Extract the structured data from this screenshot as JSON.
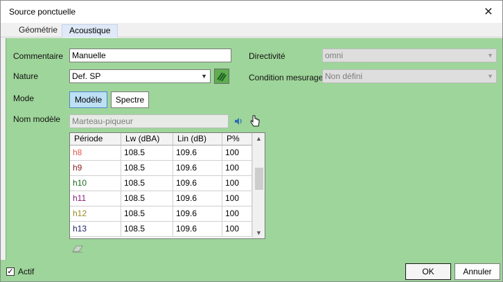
{
  "window": {
    "title": "Source ponctuelle",
    "close_glyph": "✕"
  },
  "tabs": [
    {
      "label": "Géométrie",
      "active": false
    },
    {
      "label": "Acoustique",
      "active": true
    }
  ],
  "form": {
    "commentaire_label": "Commentaire",
    "commentaire_value": "Manuelle",
    "nature_label": "Nature",
    "nature_value": "Def. SP",
    "mode_label": "Mode",
    "mode_options": [
      {
        "label": "Modèle",
        "selected": true
      },
      {
        "label": "Spectre",
        "selected": false
      }
    ],
    "nom_modele_label": "Nom modèle",
    "nom_modele_value": "Marteau-piqueur",
    "directivite_label": "Directivité",
    "directivite_value": "omni",
    "condition_label": "Condition mesurage",
    "condition_value": "Non défini"
  },
  "table": {
    "columns": [
      "Période",
      "Lw (dBA)",
      "Lin (dB)",
      "P%"
    ],
    "rows": [
      {
        "periode": "h8",
        "color": "#e0584a",
        "lw": "108.5",
        "lin": "109.6",
        "p": "100"
      },
      {
        "periode": "h9",
        "color": "#8a1d1d",
        "lw": "108.5",
        "lin": "109.6",
        "p": "100"
      },
      {
        "periode": "h10",
        "color": "#1d6a1d",
        "lw": "108.5",
        "lin": "109.6",
        "p": "100"
      },
      {
        "periode": "h11",
        "color": "#8a1d7a",
        "lw": "108.5",
        "lin": "109.6",
        "p": "100"
      },
      {
        "periode": "h12",
        "color": "#9a8a1d",
        "lw": "108.5",
        "lin": "109.6",
        "p": "100"
      },
      {
        "periode": "h13",
        "color": "#1d1d6a",
        "lw": "108.5",
        "lin": "109.6",
        "p": "100"
      }
    ]
  },
  "footer": {
    "actif_label": "Actif",
    "actif_checked": true,
    "ok_label": "OK",
    "cancel_label": "Annuler"
  },
  "icons": [
    "close-icon",
    "dropdown-caret-icon",
    "nature-edit-icon",
    "speaker-icon",
    "hand-cursor-icon",
    "eraser-icon",
    "scroll-up-icon",
    "scroll-down-icon",
    "checkbox-check-icon"
  ],
  "colors": {
    "panel": "#9ed59a",
    "active_mode": "#bde0f5",
    "window_bg": "#f0f0f0"
  }
}
